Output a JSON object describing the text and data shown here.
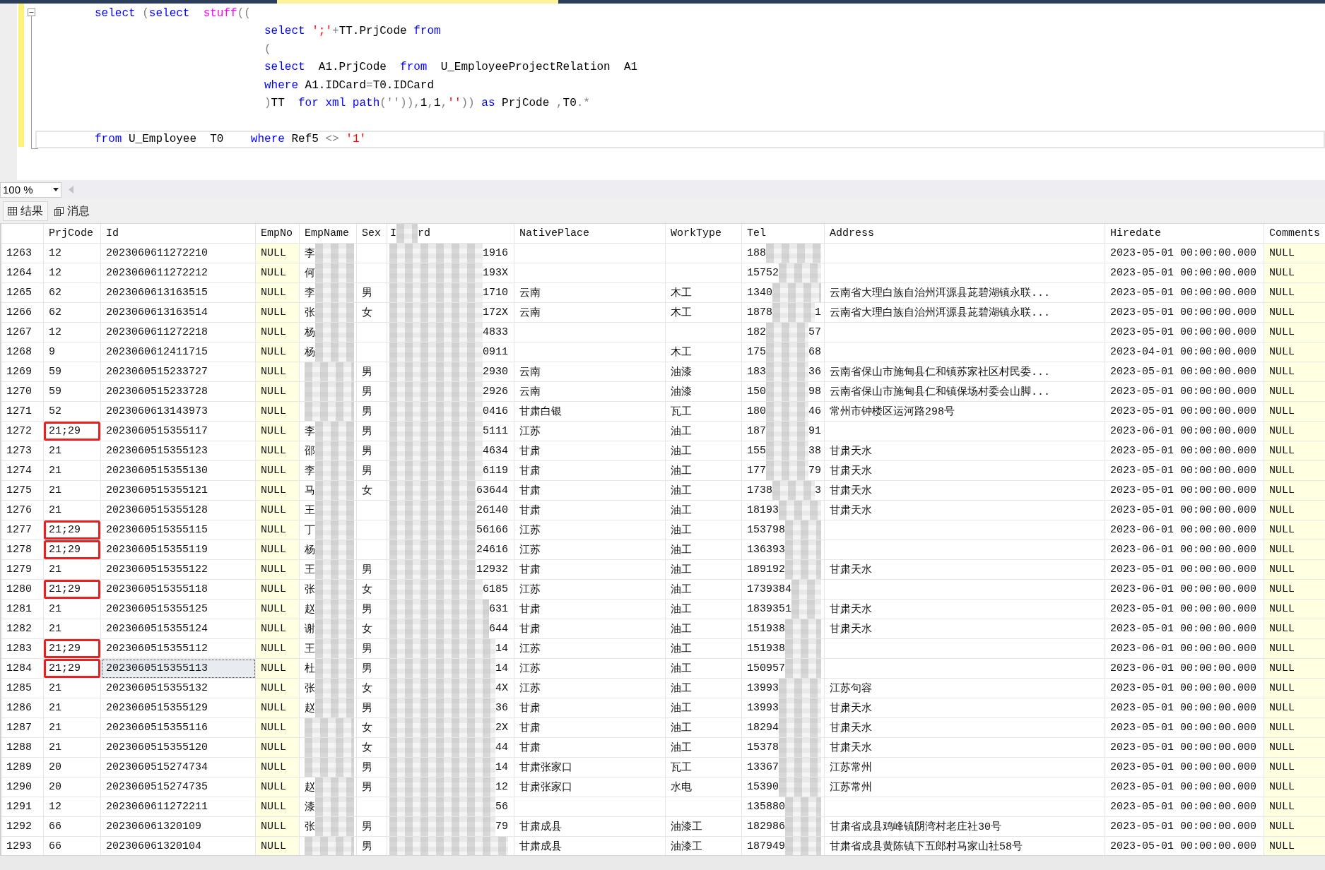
{
  "editor": {
    "lines": [
      {
        "kind": "top",
        "current": false,
        "tokens": [
          {
            "kind": "kw",
            "text": "select "
          },
          {
            "kind": "op",
            "text": "("
          },
          {
            "kind": "kw",
            "text": "select  "
          },
          {
            "kind": "fn",
            "text": "stuff"
          },
          {
            "kind": "op",
            "text": "(("
          }
        ]
      },
      {
        "kind": "nested",
        "current": false,
        "tokens": [
          {
            "kind": "kw",
            "text": "select "
          },
          {
            "kind": "str",
            "text": "';'"
          },
          {
            "kind": "op",
            "text": "+"
          },
          {
            "kind": "plain",
            "text": "TT.PrjCode "
          },
          {
            "kind": "kw",
            "text": "from"
          }
        ]
      },
      {
        "kind": "nested",
        "current": false,
        "tokens": [
          {
            "kind": "op",
            "text": "("
          }
        ]
      },
      {
        "kind": "nested",
        "current": false,
        "tokens": [
          {
            "kind": "kw",
            "text": "select  "
          },
          {
            "kind": "plain",
            "text": "A1.PrjCode  "
          },
          {
            "kind": "kw",
            "text": "from  "
          },
          {
            "kind": "plain",
            "text": "U_EmployeeProjectRelation  A1"
          }
        ]
      },
      {
        "kind": "nested",
        "current": false,
        "tokens": [
          {
            "kind": "kw",
            "text": "where "
          },
          {
            "kind": "plain",
            "text": "A1.IDCard"
          },
          {
            "kind": "op",
            "text": "="
          },
          {
            "kind": "plain",
            "text": "T0.IDCard"
          }
        ]
      },
      {
        "kind": "nested",
        "current": false,
        "tokens": [
          {
            "kind": "op",
            "text": ")"
          },
          {
            "kind": "plain",
            "text": "TT  "
          },
          {
            "kind": "kw",
            "text": "for xml path"
          },
          {
            "kind": "op",
            "text": "('')),"
          },
          {
            "kind": "plain",
            "text": "1"
          },
          {
            "kind": "op",
            "text": ","
          },
          {
            "kind": "plain",
            "text": "1"
          },
          {
            "kind": "op",
            "text": ","
          },
          {
            "kind": "str",
            "text": "''"
          },
          {
            "kind": "op",
            "text": ")) "
          },
          {
            "kind": "kw",
            "text": "as "
          },
          {
            "kind": "plain",
            "text": "PrjCode "
          },
          {
            "kind": "op",
            "text": ","
          },
          {
            "kind": "plain",
            "text": "T0"
          },
          {
            "kind": "op",
            "text": ".*"
          }
        ]
      },
      {
        "kind": "top",
        "current": false
      },
      {
        "kind": "top",
        "current": true,
        "tokens": [
          {
            "kind": "kw",
            "text": "from "
          },
          {
            "kind": "plain",
            "text": "U_Employee  T0    "
          },
          {
            "kind": "kw",
            "text": "where "
          },
          {
            "kind": "plain",
            "text": "Ref5 "
          },
          {
            "kind": "op",
            "text": "<> "
          },
          {
            "kind": "str",
            "text": "'1'"
          }
        ]
      }
    ]
  },
  "zoom": {
    "value": "100 %"
  },
  "result_tabs": [
    {
      "label": "结果",
      "kind": "results",
      "selected": true
    },
    {
      "label": "消息",
      "kind": "messages",
      "selected": false
    }
  ],
  "table": {
    "columns": [
      {
        "kind": "text",
        "label": "PrjCode"
      },
      {
        "kind": "text",
        "label": "Id"
      },
      {
        "kind": "text",
        "label": "EmpNo"
      },
      {
        "kind": "text",
        "label": "EmpName"
      },
      {
        "kind": "text",
        "label": "Sex"
      },
      {
        "kind": "redacted",
        "head": "I",
        "tail": "rd"
      },
      {
        "kind": "text",
        "label": "NativePlace"
      },
      {
        "kind": "text",
        "label": "WorkType"
      },
      {
        "kind": "text",
        "label": "Tel"
      },
      {
        "kind": "text",
        "label": "Address"
      },
      {
        "kind": "text",
        "label": "Hiredate"
      },
      {
        "kind": "text",
        "label": "Comments"
      }
    ],
    "rows": [
      {
        "num": "1263",
        "prj": "12",
        "id": "2023060611272210",
        "empno": "NULL",
        "name": "李",
        "idtail": "1916",
        "tel": "188",
        "hiredate": "2023-05-01 00:00:00.000",
        "comments": "NULL",
        "highlighted": false,
        "focused": false
      },
      {
        "num": "1264",
        "prj": "12",
        "id": "2023060611272212",
        "empno": "NULL",
        "name": "何",
        "idtail": "193X",
        "tel": "15752",
        "hiredate": "2023-05-01 00:00:00.000",
        "comments": "NULL",
        "highlighted": false,
        "focused": false
      },
      {
        "num": "1265",
        "prj": "62",
        "id": "2023060613163515",
        "empno": "NULL",
        "name": "李",
        "sex": "男",
        "idtail": "1710",
        "native": "云南",
        "work": "木工",
        "tel": "1340",
        "address": "云南省大理白族自治州洱源县茈碧湖镇永联...",
        "hiredate": "2023-05-01 00:00:00.000",
        "comments": "NULL",
        "highlighted": false,
        "focused": false
      },
      {
        "num": "1266",
        "prj": "62",
        "id": "2023060613163514",
        "empno": "NULL",
        "name": "张",
        "sex": "女",
        "idtail": "172X",
        "native": "云南",
        "work": "木工",
        "tel": "1878",
        "tel_tail": "1",
        "address": "云南省大理白族自治州洱源县茈碧湖镇永联...",
        "hiredate": "2023-05-01 00:00:00.000",
        "comments": "NULL",
        "highlighted": false,
        "focused": false
      },
      {
        "num": "1267",
        "prj": "12",
        "id": "2023060611272218",
        "empno": "NULL",
        "name": "杨",
        "idtail": "4833",
        "tel": "182",
        "tel_tail": "57",
        "hiredate": "2023-05-01 00:00:00.000",
        "comments": "NULL",
        "highlighted": false,
        "focused": false
      },
      {
        "num": "1268",
        "prj": "9",
        "id": "2023060612411715",
        "empno": "NULL",
        "name": "杨",
        "idtail": "0911",
        "work": "木工",
        "tel": "175",
        "tel_tail": "68",
        "hiredate": "2023-04-01 00:00:00.000",
        "comments": "NULL",
        "highlighted": false,
        "focused": false
      },
      {
        "num": "1269",
        "prj": "59",
        "id": "2023060515233727",
        "empno": "NULL",
        "sex": "男",
        "idtail": "2930",
        "native": "云南",
        "work": "油漆",
        "tel": "183",
        "tel_tail": "36",
        "address": "云南省保山市施甸县仁和镇苏家社区村民委...",
        "hiredate": "2023-05-01 00:00:00.000",
        "comments": "NULL",
        "highlighted": false,
        "focused": false
      },
      {
        "num": "1270",
        "prj": "59",
        "id": "2023060515233728",
        "empno": "NULL",
        "sex": "男",
        "idtail": "2926",
        "native": "云南",
        "work": "油漆",
        "tel": "150",
        "tel_tail": "98",
        "address": "云南省保山市施甸县仁和镇保场村委会山脚...",
        "hiredate": "2023-05-01 00:00:00.000",
        "comments": "NULL",
        "highlighted": false,
        "focused": false
      },
      {
        "num": "1271",
        "prj": "52",
        "id": "2023060613143973",
        "empno": "NULL",
        "sex": "男",
        "idtail": "0416",
        "native": "甘肃白银",
        "work": "瓦工",
        "tel": "180",
        "tel_tail": "46",
        "address": "常州市钟楼区运河路298号",
        "hiredate": "2023-05-01 00:00:00.000",
        "comments": "NULL",
        "highlighted": false,
        "focused": false
      },
      {
        "num": "1272",
        "prj": "21;29",
        "id": "2023060515355117",
        "empno": "NULL",
        "name": "李",
        "sex": "男",
        "idtail": "5111",
        "native": "江苏",
        "work": "油工",
        "tel": "187",
        "tel_tail": "91",
        "hiredate": "2023-06-01 00:00:00.000",
        "comments": "NULL",
        "highlighted": true,
        "focused": false
      },
      {
        "num": "1273",
        "prj": "21",
        "id": "2023060515355123",
        "empno": "NULL",
        "name": "邵",
        "sex": "男",
        "idtail": "4634",
        "native": "甘肃",
        "work": "油工",
        "tel": "155",
        "tel_tail": "38",
        "address": "甘肃天水",
        "hiredate": "2023-05-01 00:00:00.000",
        "comments": "NULL",
        "highlighted": false,
        "focused": false
      },
      {
        "num": "1274",
        "prj": "21",
        "id": "2023060515355130",
        "empno": "NULL",
        "name": "李",
        "sex": "男",
        "idtail": "6119",
        "native": "甘肃",
        "work": "油工",
        "tel": "177",
        "tel_tail": "79",
        "address": "甘肃天水",
        "hiredate": "2023-05-01 00:00:00.000",
        "comments": "NULL",
        "highlighted": false,
        "focused": false
      },
      {
        "num": "1275",
        "prj": "21",
        "id": "2023060515355121",
        "empno": "NULL",
        "name": "马",
        "sex": "女",
        "idtail": "63644",
        "native": "甘肃",
        "work": "油工",
        "tel": "1738",
        "tel_tail": "3",
        "address": "甘肃天水",
        "hiredate": "2023-05-01 00:00:00.000",
        "comments": "NULL",
        "highlighted": false,
        "focused": false
      },
      {
        "num": "1276",
        "prj": "21",
        "id": "2023060515355128",
        "empno": "NULL",
        "name": "王",
        "idtail": "26140",
        "native": "甘肃",
        "work": "油工",
        "tel": "18193",
        "address": "甘肃天水",
        "hiredate": "2023-05-01 00:00:00.000",
        "comments": "NULL",
        "highlighted": false,
        "focused": false
      },
      {
        "num": "1277",
        "prj": "21;29",
        "id": "2023060515355115",
        "empno": "NULL",
        "name": "丁",
        "idtail": "56166",
        "native": "江苏",
        "work": "油工",
        "tel": "153798",
        "hiredate": "2023-06-01 00:00:00.000",
        "comments": "NULL",
        "highlighted": true,
        "focused": false
      },
      {
        "num": "1278",
        "prj": "21;29",
        "id": "2023060515355119",
        "empno": "NULL",
        "name": "杨",
        "idtail": "24616",
        "native": "江苏",
        "work": "油工",
        "tel": "136393",
        "hiredate": "2023-06-01 00:00:00.000",
        "comments": "NULL",
        "highlighted": true,
        "focused": false
      },
      {
        "num": "1279",
        "prj": "21",
        "id": "2023060515355122",
        "empno": "NULL",
        "name": "王",
        "sex": "男",
        "idtail": "12932",
        "native": "甘肃",
        "work": "油工",
        "tel": "189192",
        "address": "甘肃天水",
        "hiredate": "2023-05-01 00:00:00.000",
        "comments": "NULL",
        "highlighted": false,
        "focused": false
      },
      {
        "num": "1280",
        "prj": "21;29",
        "id": "2023060515355118",
        "empno": "NULL",
        "name": "张",
        "sex": "女",
        "idtail": "6185",
        "native": "江苏",
        "work": "油工",
        "tel": "1739384",
        "hiredate": "2023-06-01 00:00:00.000",
        "comments": "NULL",
        "highlighted": true,
        "focused": false
      },
      {
        "num": "1281",
        "prj": "21",
        "id": "2023060515355125",
        "empno": "NULL",
        "name": "赵",
        "sex": "男",
        "idtail": "631",
        "native": "甘肃",
        "work": "油工",
        "tel": "1839351",
        "address": "甘肃天水",
        "hiredate": "2023-05-01 00:00:00.000",
        "comments": "NULL",
        "highlighted": false,
        "focused": false
      },
      {
        "num": "1282",
        "prj": "21",
        "id": "2023060515355124",
        "empno": "NULL",
        "name": "谢",
        "sex": "女",
        "idtail": "644",
        "native": "甘肃",
        "work": "油工",
        "tel": "151938",
        "address": "甘肃天水",
        "hiredate": "2023-05-01 00:00:00.000",
        "comments": "NULL",
        "highlighted": false,
        "focused": false
      },
      {
        "num": "1283",
        "prj": "21;29",
        "id": "2023060515355112",
        "empno": "NULL",
        "name": "王",
        "sex": "男",
        "idtail": "14",
        "native": "江苏",
        "work": "油工",
        "tel": "151938",
        "hiredate": "2023-06-01 00:00:00.000",
        "comments": "NULL",
        "highlighted": true,
        "focused": false
      },
      {
        "num": "1284",
        "prj": "21;29",
        "id": "2023060515355113",
        "empno": "NULL",
        "name": "杜",
        "sex": "男",
        "idtail": "14",
        "native": "江苏",
        "work": "油工",
        "tel": "150957",
        "hiredate": "2023-06-01 00:00:00.000",
        "comments": "NULL",
        "highlighted": true,
        "focused": true
      },
      {
        "num": "1285",
        "prj": "21",
        "id": "2023060515355132",
        "empno": "NULL",
        "name": "张",
        "sex": "女",
        "idtail": "4X",
        "native": "江苏",
        "work": "油工",
        "tel": "13993",
        "address": "江苏句容",
        "hiredate": "2023-05-01 00:00:00.000",
        "comments": "NULL",
        "highlighted": false,
        "focused": false
      },
      {
        "num": "1286",
        "prj": "21",
        "id": "2023060515355129",
        "empno": "NULL",
        "name": "赵",
        "sex": "男",
        "idtail": "36",
        "native": "甘肃",
        "work": "油工",
        "tel": "13993",
        "address": "甘肃天水",
        "hiredate": "2023-05-01 00:00:00.000",
        "comments": "NULL",
        "highlighted": false,
        "focused": false
      },
      {
        "num": "1287",
        "prj": "21",
        "id": "2023060515355116",
        "empno": "NULL",
        "sex": "女",
        "idtail": "2X",
        "native": "甘肃",
        "work": "油工",
        "tel": "18294",
        "address": "甘肃天水",
        "hiredate": "2023-05-01 00:00:00.000",
        "comments": "NULL",
        "highlighted": false,
        "focused": false
      },
      {
        "num": "1288",
        "prj": "21",
        "id": "2023060515355120",
        "empno": "NULL",
        "sex": "女",
        "idtail": "44",
        "native": "甘肃",
        "work": "油工",
        "tel": "15378",
        "address": "甘肃天水",
        "hiredate": "2023-05-01 00:00:00.000",
        "comments": "NULL",
        "highlighted": false,
        "focused": false
      },
      {
        "num": "1289",
        "prj": "20",
        "id": "2023060515274734",
        "empno": "NULL",
        "sex": "男",
        "idtail": "14",
        "native": "甘肃张家口",
        "work": "瓦工",
        "tel": "13367",
        "address": "江苏常州",
        "hiredate": "2023-05-01 00:00:00.000",
        "comments": "NULL",
        "highlighted": false,
        "focused": false
      },
      {
        "num": "1290",
        "prj": "20",
        "id": "2023060515274735",
        "empno": "NULL",
        "name": "赵",
        "sex": "男",
        "idtail": "12",
        "native": "甘肃张家口",
        "work": "水电",
        "tel": "15390",
        "address": "江苏常州",
        "hiredate": "2023-05-01 00:00:00.000",
        "comments": "NULL",
        "highlighted": false,
        "focused": false
      },
      {
        "num": "1291",
        "prj": "12",
        "id": "2023060611272211",
        "empno": "NULL",
        "name": "漆",
        "idtail": "56",
        "tel": "135880",
        "hiredate": "2023-05-01 00:00:00.000",
        "comments": "NULL",
        "highlighted": false,
        "focused": false
      },
      {
        "num": "1292",
        "prj": "66",
        "id": "202306061320109",
        "empno": "NULL",
        "name": "张",
        "sex": "男",
        "idtail": "79",
        "native": "甘肃成县",
        "work": "油漆工",
        "tel": "182986",
        "address": "甘肃省成县鸡峰镇阴湾村老庄社30号",
        "hiredate": "2023-05-01 00:00:00.000",
        "comments": "NULL",
        "highlighted": false,
        "focused": false
      },
      {
        "num": "1293",
        "prj": "66",
        "id": "202306061320104",
        "empno": "NULL",
        "sex": "男",
        "native": "甘肃成县",
        "work": "油漆工",
        "tel": "187949",
        "address": "甘肃省成县黄陈镇下五郎村马家山社58号",
        "hiredate": "2023-05-01 00:00:00.000",
        "comments": "NULL",
        "highlighted": false,
        "focused": false
      }
    ]
  }
}
